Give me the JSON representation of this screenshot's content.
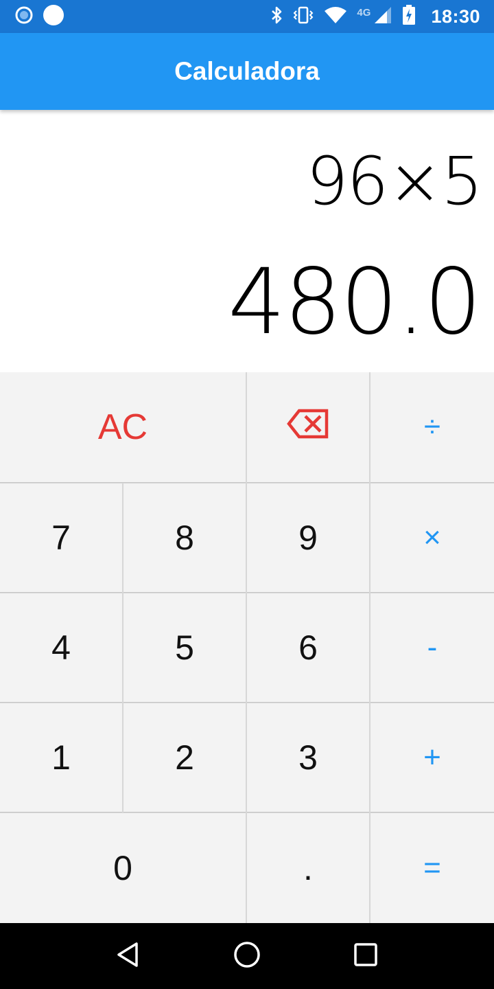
{
  "status_bar": {
    "time": "18:30",
    "network": "4G",
    "icons": [
      "notification-circle-icon",
      "dot-icon",
      "bluetooth-icon",
      "vibrate-icon",
      "wifi-icon",
      "signal-icon",
      "battery-charging-icon"
    ]
  },
  "app_bar": {
    "title": "Calculadora",
    "color": "#2196F3"
  },
  "display": {
    "expression": "96×5",
    "result": "480.0"
  },
  "keypad": {
    "ac": "AC",
    "backspace_icon": "backspace-icon",
    "divide": "÷",
    "seven": "7",
    "eight": "8",
    "nine": "9",
    "multiply": "×",
    "four": "4",
    "five": "5",
    "six": "6",
    "minus": "-",
    "one": "1",
    "two": "2",
    "three": "3",
    "plus": "+",
    "zero": "0",
    "dot": ".",
    "equals": "=",
    "operator_color": "#2196F3",
    "clear_color": "#E53935"
  },
  "nav_bar": {
    "buttons": [
      "back-icon",
      "home-icon",
      "recents-icon"
    ]
  }
}
